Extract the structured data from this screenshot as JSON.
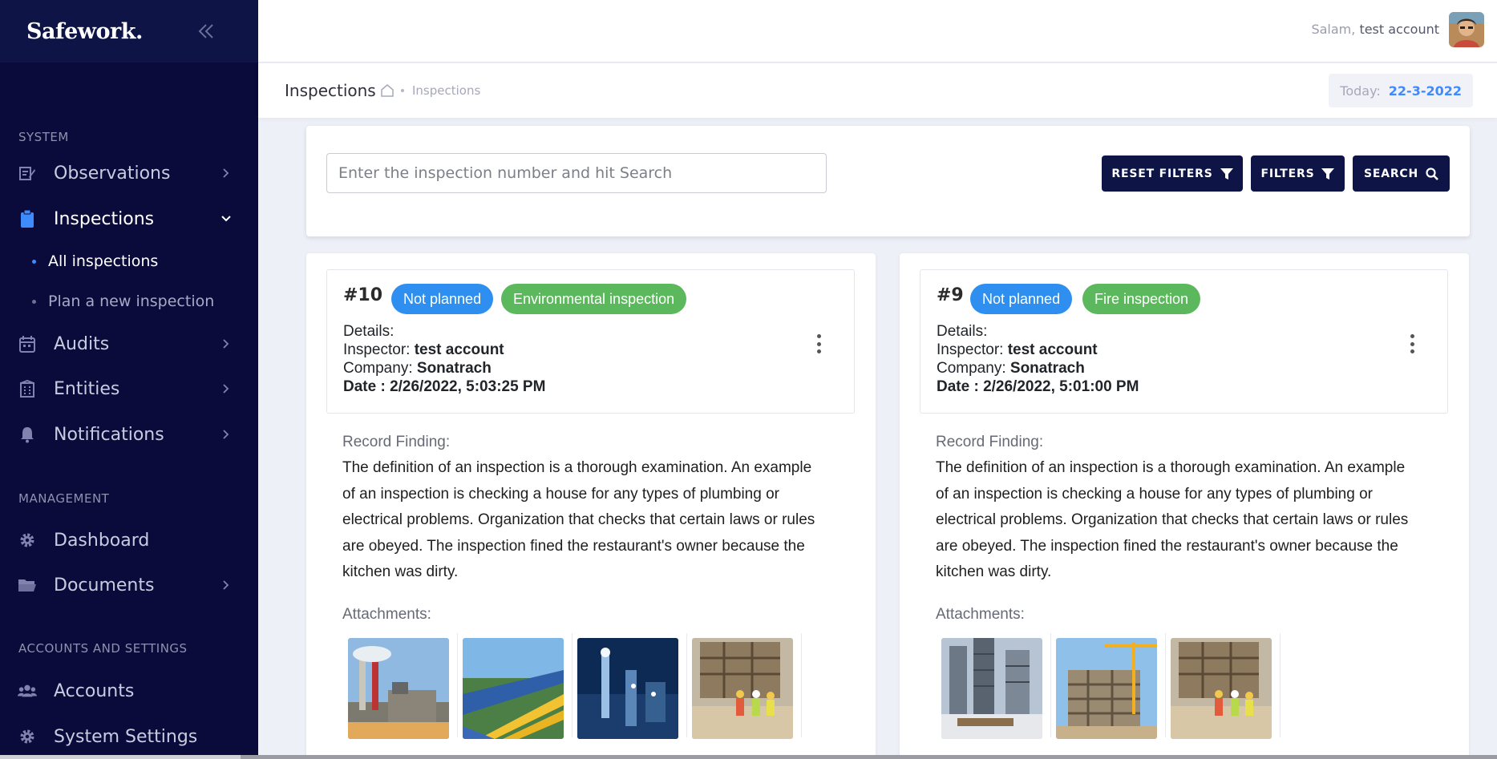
{
  "app": {
    "brand": "Safework."
  },
  "sidebar": {
    "sections": {
      "system": "SYSTEM",
      "management": "MANAGEMENT",
      "accounts": "ACCOUNTS AND SETTINGS"
    },
    "items": [
      {
        "label": "Observations",
        "icon": "edit-note-icon"
      },
      {
        "label": "Inspections",
        "icon": "clipboard-icon",
        "expanded": true
      },
      {
        "label": "Audits",
        "icon": "calendar-icon"
      },
      {
        "label": "Entities",
        "icon": "building-icon"
      },
      {
        "label": "Notifications",
        "icon": "bell-icon"
      },
      {
        "label": "Dashboard",
        "icon": "gear-icon"
      },
      {
        "label": "Documents",
        "icon": "folder-icon"
      },
      {
        "label": "Accounts",
        "icon": "users-icon"
      },
      {
        "label": "System Settings",
        "icon": "gear-icon"
      }
    ],
    "subitems": [
      {
        "label": "All inspections",
        "active": true
      },
      {
        "label": "Plan a new inspection",
        "active": false
      }
    ]
  },
  "topbar": {
    "greeting_prefix": "Salam,",
    "user_name": "test account"
  },
  "subheader": {
    "title": "Inspections",
    "breadcrumb": "Inspections",
    "today_label": "Today:",
    "today_date": "22-3-2022"
  },
  "search": {
    "placeholder": "Enter the inspection number and hit Search",
    "reset_label": "RESET FILTERS",
    "filters_label": "FILTERS",
    "search_label": "SEARCH"
  },
  "inspections": [
    {
      "number": "#10",
      "status": "Not planned",
      "type": "Environmental inspection",
      "details_label": "Details:",
      "inspector_label": "Inspector:",
      "inspector": "test account",
      "company_label": "Company:",
      "company": "Sonatrach",
      "date_label": "Date :",
      "date": "2/26/2022, 5:03:25 PM",
      "record_label": "Record Finding:",
      "record": "The definition of an inspection is a thorough examination. An example of an inspection is checking a house for any types of plumbing or electrical problems. Organization that checks that certain laws or rules are obeyed. The inspection fined the restaurant's owner because the kitchen was dirty.",
      "attachments_label": "Attachments:",
      "attachments": [
        "factory-smokestacks",
        "yellow-pipeline",
        "refinery-night",
        "construction-workers"
      ]
    },
    {
      "number": "#9",
      "status": "Not planned",
      "type": "Fire inspection",
      "details_label": "Details:",
      "inspector_label": "Inspector:",
      "inspector": "test account",
      "company_label": "Company:",
      "company": "Sonatrach",
      "date_label": "Date :",
      "date": "2/26/2022, 5:01:00 PM",
      "record_label": "Record Finding:",
      "record": "The definition of an inspection is a thorough examination. An example of an inspection is checking a house for any types of plumbing or electrical problems. Organization that checks that certain laws or rules are obeyed. The inspection fined the restaurant's owner because the kitchen was dirty.",
      "attachments_label": "Attachments:",
      "attachments": [
        "city-construction",
        "building-crane",
        "construction-workers"
      ]
    }
  ],
  "colors": {
    "sidebar": "#0b0b3b",
    "accent": "#3d8bfd",
    "button": "#0e1446",
    "badge_blue": "#2f8ff0",
    "badge_green": "#5cb85c"
  }
}
